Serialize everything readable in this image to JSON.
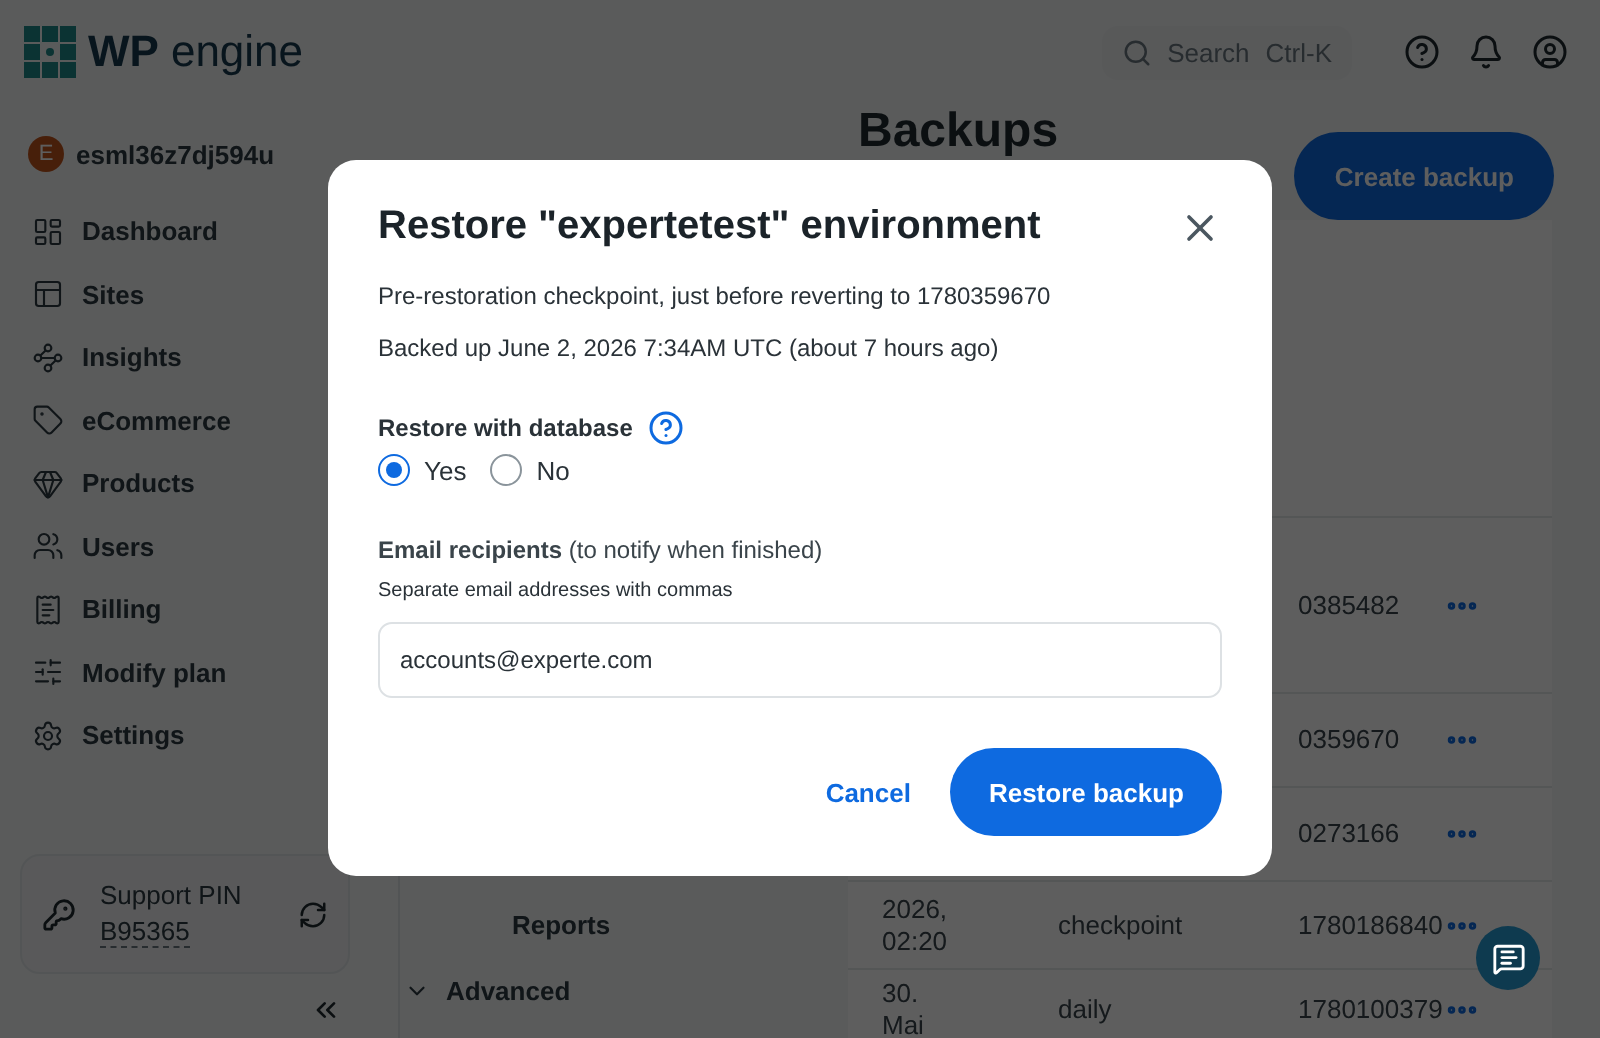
{
  "header": {
    "logo_mark": "WP",
    "logo_word": "engine",
    "search": {
      "placeholder": "Search",
      "shortcut": "Ctrl-K"
    }
  },
  "account": {
    "initial": "E",
    "name": "esml36z7dj594u"
  },
  "sidebar": {
    "items": [
      {
        "label": "Dashboard"
      },
      {
        "label": "Sites"
      },
      {
        "label": "Insights"
      },
      {
        "label": "eCommerce"
      },
      {
        "label": "Products"
      },
      {
        "label": "Users"
      },
      {
        "label": "Billing"
      },
      {
        "label": "Modify plan"
      },
      {
        "label": "Settings"
      }
    ]
  },
  "support": {
    "label": "Support PIN",
    "pin": "B95365"
  },
  "page": {
    "title": "Backups",
    "create_button": "Create backup",
    "nav": [
      {
        "kind": "link",
        "label": "Reports"
      },
      {
        "kind": "section",
        "label": "Advanced",
        "expanded": true
      }
    ],
    "rows": [
      {
        "id": "0385482"
      },
      {
        "id": "0359670"
      },
      {
        "id": "0273166"
      },
      {
        "date": "2026,\n02:20",
        "type": "checkpoint",
        "id": "1780186840"
      },
      {
        "date": "30.\nMai",
        "type": "daily",
        "id": "1780100379"
      }
    ]
  },
  "modal": {
    "title": "Restore \"expertetest\" environment",
    "lines": [
      "Pre-restoration checkpoint, just before reverting to 1780359670",
      "Backed up June 2, 2026 7:34AM UTC (about 7 hours ago)"
    ],
    "database": {
      "label": "Restore with database",
      "options": [
        {
          "label": "Yes",
          "selected": true
        },
        {
          "label": "No",
          "selected": false
        }
      ]
    },
    "email": {
      "label": "**Email recipients** (to notify when finished)",
      "hint": "Separate email addresses with commas",
      "value": "accounts@experte.com"
    },
    "cancel": "Cancel",
    "submit": "Restore backup"
  }
}
